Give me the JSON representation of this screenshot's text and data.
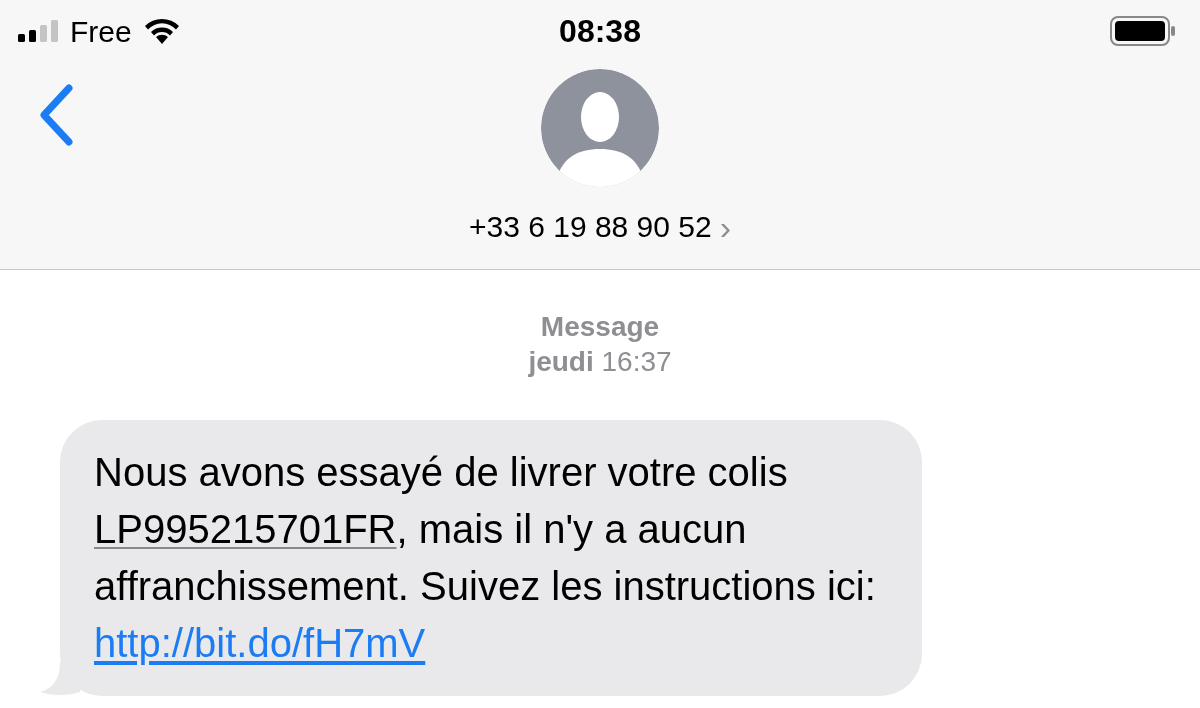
{
  "status_bar": {
    "carrier": "Free",
    "time": "08:38"
  },
  "header": {
    "contact": "+33 6 19 88 90 52",
    "chevron": "›"
  },
  "conversation": {
    "service": "Message",
    "timestamp": "**jeudi** 16:37",
    "message": {
      "parts": [
        {
          "kind": "plain",
          "text": "Nous avons essayé de livrer votre colis "
        },
        {
          "kind": "tracking",
          "text": "LP995215701FR"
        },
        {
          "kind": "plain",
          "text": ", mais il n'y a aucun affranchissement. Suivez les instructions ici: "
        },
        {
          "kind": "link",
          "text": "http://bit.do/fH7mV"
        }
      ]
    }
  }
}
